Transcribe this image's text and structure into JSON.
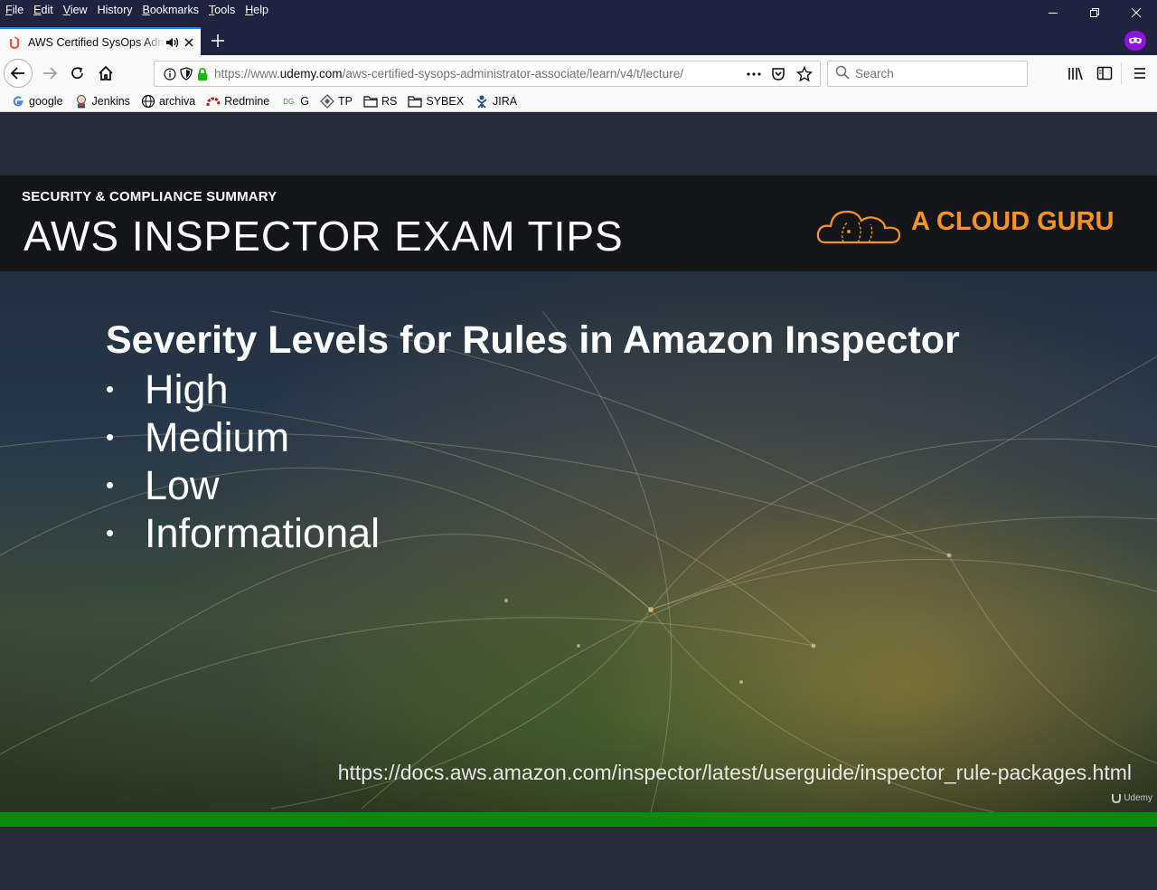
{
  "menu": {
    "items": [
      {
        "key": "F",
        "rest": "ile"
      },
      {
        "key": "E",
        "rest": "dit"
      },
      {
        "key": "V",
        "rest": "iew"
      },
      {
        "key": "H",
        "rest": "istory",
        "underline_index": 2
      },
      {
        "key": "B",
        "rest": "ookmarks"
      },
      {
        "key": "T",
        "rest": "ools"
      },
      {
        "key": "H",
        "rest": "elp"
      }
    ]
  },
  "tab": {
    "title": "AWS Certified SysOps Administrator - Associate",
    "favicon": "udemy-icon",
    "audio": "speaker-icon"
  },
  "navbar": {
    "url_prefix": "https://www.",
    "url_host": "udemy.com",
    "url_path": "/aws-certified-sysops-administrator-associate/learn/v4/t/lecture/",
    "search_placeholder": "Search"
  },
  "bookmarks": [
    {
      "label": "google",
      "icon": "google-icon"
    },
    {
      "label": "Jenkins",
      "icon": "jenkins-icon"
    },
    {
      "label": "archiva",
      "icon": "globe-icon"
    },
    {
      "label": "Redmine",
      "icon": "redmine-icon"
    },
    {
      "label": "G",
      "icon": "dg-icon"
    },
    {
      "label": "TP",
      "icon": "tp-icon"
    },
    {
      "label": "RS",
      "icon": "folder-icon"
    },
    {
      "label": "SYBEX",
      "icon": "folder-icon"
    },
    {
      "label": "JIRA",
      "icon": "jira-icon"
    }
  ],
  "slide": {
    "subtitle": "SECURITY & COMPLIANCE SUMMARY",
    "title": "AWS INSPECTOR EXAM TIPS",
    "brand": "A CLOUD GURU",
    "heading": "Severity Levels for Rules in Amazon Inspector",
    "bullets": [
      "High",
      "Medium",
      "Low",
      "Informational"
    ],
    "bullet_char": "•",
    "url": "https://docs.aws.amazon.com/inspector/latest/userguide/inspector_rule-packages.html",
    "watermark": "Udemy"
  },
  "colors": {
    "titlebar": "#202340",
    "accent_tab": "#0a84ff",
    "brand_orange": "#f7941d",
    "progress_green": "#0a8a0a",
    "private_purple": "#8e14d9"
  }
}
